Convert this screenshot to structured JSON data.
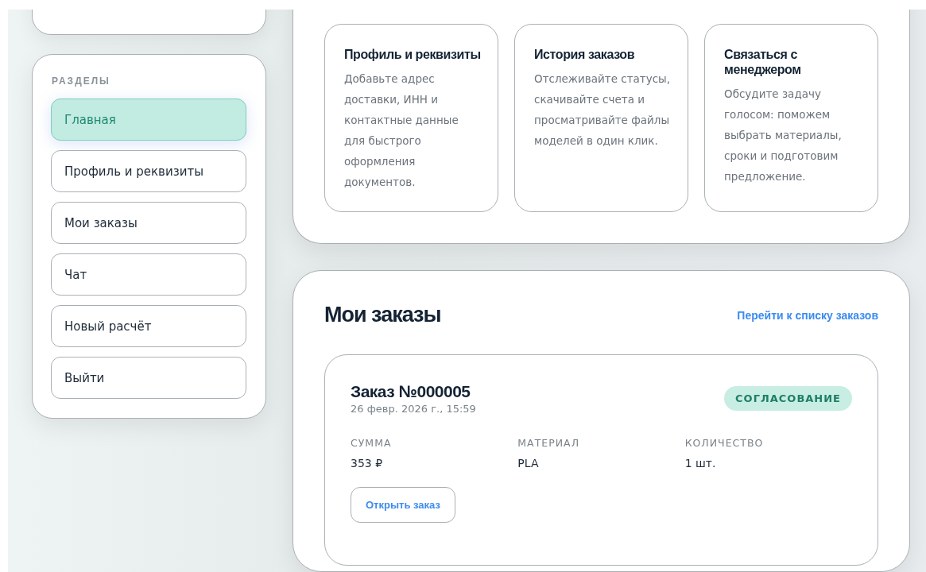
{
  "sidebar": {
    "heading": "РАЗДЕЛЫ",
    "items": [
      {
        "label": "Главная",
        "selected": true
      },
      {
        "label": "Профиль и реквизиты",
        "selected": false
      },
      {
        "label": "Мои заказы",
        "selected": false
      },
      {
        "label": "Чат",
        "selected": false
      },
      {
        "label": "Новый расчёт",
        "selected": false
      },
      {
        "label": "Выйти",
        "selected": false
      }
    ]
  },
  "features": [
    {
      "title": "Профиль и реквизиты",
      "text": "Добавьте адрес доставки, ИНН и контактные данные для быстрого оформления документов."
    },
    {
      "title": "История заказов",
      "text": "Отслеживайте статусы, скачивайте счета и просматривайте файлы моделей в один клик."
    },
    {
      "title": "Связаться с менеджером",
      "text": "Обсудите задачу голосом: поможем выбрать материалы, сроки и подготовим предложение."
    }
  ],
  "orders": {
    "title": "Мои заказы",
    "link": "Перейти к списку заказов",
    "items": [
      {
        "number": "Заказ №000005",
        "date": "26 февр. 2026 г., 15:59",
        "status": "СОГЛАСОВАНИЕ",
        "fields": [
          {
            "label": "СУММА",
            "value": "353 ₽"
          },
          {
            "label": "МАТЕРИАЛ",
            "value": "PLA"
          },
          {
            "label": "КОЛИЧЕСТВО",
            "value": "1 шт."
          }
        ],
        "button": "Открыть заказ"
      }
    ]
  }
}
